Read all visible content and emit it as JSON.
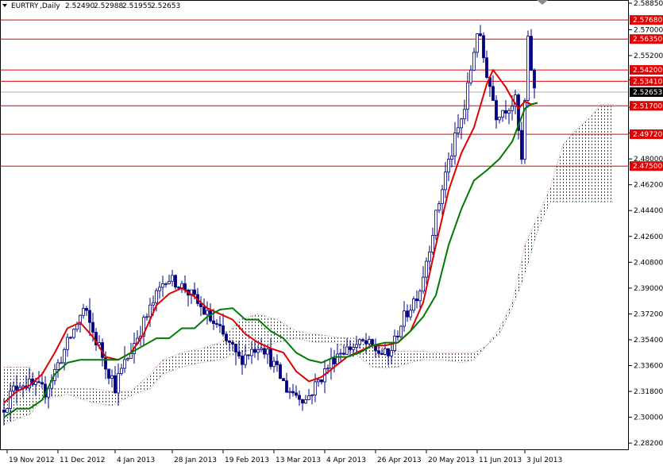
{
  "window": {
    "symbol": "EURTRY",
    "timeframe": "Daily",
    "ohlc": [
      "2.52490",
      "2.52988",
      "2.51955",
      "2.52653"
    ]
  },
  "chart_data": {
    "type": "candlestick",
    "title": "EURTRY,Daily",
    "ylim": [
      2.2782,
      2.5885
    ],
    "y_ticks": [
      2.5885,
      2.57,
      2.552,
      2.535,
      2.516,
      2.498,
      2.48,
      2.462,
      2.444,
      2.426,
      2.408,
      2.39,
      2.372,
      2.354,
      2.336,
      2.318,
      2.3,
      2.282
    ],
    "y_tick_labels": [
      "2.58850",
      "2.57000",
      "2.55200",
      "2.53500",
      "2.51600",
      "2.49800",
      "2.48000",
      "2.46200",
      "2.44400",
      "2.42600",
      "2.40800",
      "2.39000",
      "2.37200",
      "2.35400",
      "2.33600",
      "2.31800",
      "2.30000",
      "2.28200"
    ],
    "x_tick_labels": [
      "19 Nov 2012",
      "11 Dec 2012",
      "4 Jan 2013",
      "28 Jan 2013",
      "19 Feb 2013",
      "13 Mar 2013",
      "4 Apr 2013",
      "26 Apr 2013",
      "20 May 2013",
      "11 Jun 2013",
      "3 Jul 2013"
    ],
    "x_tick_index": [
      1,
      17,
      35,
      53,
      69,
      85,
      101,
      117,
      133,
      149,
      164
    ],
    "horizontal_levels": [
      {
        "value": 2.5768,
        "label": "2.57680"
      },
      {
        "value": 2.5635,
        "label": "2.56350"
      },
      {
        "value": 2.542,
        "label": "2.54200"
      },
      {
        "value": 2.5341,
        "label": "2.53410"
      },
      {
        "value": 2.517,
        "label": "2.51700"
      },
      {
        "value": 2.4972,
        "label": "2.49720"
      },
      {
        "value": 2.475,
        "label": "2.47500"
      }
    ],
    "current_price": {
      "value": 2.52653,
      "label": "2.52653"
    },
    "bars": [
      {
        "seg": [
          0,
          6
        ],
        "from": 2.305,
        "to": 2.325,
        "amp": 0.012
      },
      {
        "seg": [
          6,
          14
        ],
        "from": 2.325,
        "to": 2.318,
        "amp": 0.01
      },
      {
        "seg": [
          14,
          26
        ],
        "from": 2.318,
        "to": 2.375,
        "amp": 0.01
      },
      {
        "seg": [
          26,
          36
        ],
        "from": 2.375,
        "to": 2.322,
        "amp": 0.012
      },
      {
        "seg": [
          36,
          42
        ],
        "from": 2.322,
        "to": 2.352,
        "amp": 0.012
      },
      {
        "seg": [
          42,
          52
        ],
        "from": 2.352,
        "to": 2.398,
        "amp": 0.01
      },
      {
        "seg": [
          52,
          58
        ],
        "from": 2.398,
        "to": 2.39,
        "amp": 0.008
      },
      {
        "seg": [
          58,
          66
        ],
        "from": 2.39,
        "to": 2.368,
        "amp": 0.01
      },
      {
        "seg": [
          66,
          75
        ],
        "from": 2.368,
        "to": 2.34,
        "amp": 0.012
      },
      {
        "seg": [
          75,
          82
        ],
        "from": 2.34,
        "to": 2.352,
        "amp": 0.01
      },
      {
        "seg": [
          82,
          90
        ],
        "from": 2.352,
        "to": 2.32,
        "amp": 0.01
      },
      {
        "seg": [
          90,
          96
        ],
        "from": 2.32,
        "to": 2.312,
        "amp": 0.008
      },
      {
        "seg": [
          96,
          106
        ],
        "from": 2.312,
        "to": 2.345,
        "amp": 0.01
      },
      {
        "seg": [
          106,
          114
        ],
        "from": 2.345,
        "to": 2.352,
        "amp": 0.008
      },
      {
        "seg": [
          114,
          122
        ],
        "from": 2.352,
        "to": 2.342,
        "amp": 0.01
      },
      {
        "seg": [
          122,
          126
        ],
        "from": 2.342,
        "to": 2.365,
        "amp": 0.008
      },
      {
        "seg": [
          126,
          132
        ],
        "from": 2.365,
        "to": 2.39,
        "amp": 0.01
      },
      {
        "seg": [
          132,
          140
        ],
        "from": 2.39,
        "to": 2.47,
        "amp": 0.01
      },
      {
        "seg": [
          140,
          146
        ],
        "from": 2.47,
        "to": 2.515,
        "amp": 0.012
      },
      {
        "seg": [
          146,
          150
        ],
        "from": 2.515,
        "to": 2.57,
        "amp": 0.012
      },
      {
        "seg": [
          150,
          156
        ],
        "from": 2.57,
        "to": 2.512,
        "amp": 0.012
      },
      {
        "seg": [
          156,
          162
        ],
        "from": 2.512,
        "to": 2.52,
        "amp": 0.01
      },
      {
        "seg": [
          162,
          164
        ],
        "from": 2.52,
        "to": 2.478,
        "amp": 0.008
      },
      {
        "seg": [
          164,
          166
        ],
        "from": 2.478,
        "to": 2.56,
        "amp": 0.012
      },
      {
        "seg": [
          166,
          168
        ],
        "from": 2.56,
        "to": 2.527,
        "amp": 0.01
      }
    ],
    "series": [
      {
        "name": "",
        "color": "#e00000",
        "points": [
          [
            0,
            2.31
          ],
          [
            4,
            2.318
          ],
          [
            8,
            2.322
          ],
          [
            12,
            2.33
          ],
          [
            16,
            2.345
          ],
          [
            20,
            2.362
          ],
          [
            24,
            2.366
          ],
          [
            28,
            2.356
          ],
          [
            32,
            2.342
          ],
          [
            36,
            2.34
          ],
          [
            40,
            2.345
          ],
          [
            44,
            2.358
          ],
          [
            48,
            2.378
          ],
          [
            52,
            2.386
          ],
          [
            56,
            2.39
          ],
          [
            60,
            2.384
          ],
          [
            64,
            2.376
          ],
          [
            68,
            2.372
          ],
          [
            72,
            2.368
          ],
          [
            76,
            2.358
          ],
          [
            80,
            2.352
          ],
          [
            84,
            2.348
          ],
          [
            88,
            2.345
          ],
          [
            92,
            2.332
          ],
          [
            96,
            2.325
          ],
          [
            100,
            2.328
          ],
          [
            104,
            2.335
          ],
          [
            108,
            2.342
          ],
          [
            112,
            2.346
          ],
          [
            116,
            2.35
          ],
          [
            120,
            2.35
          ],
          [
            124,
            2.352
          ],
          [
            128,
            2.36
          ],
          [
            132,
            2.38
          ],
          [
            136,
            2.42
          ],
          [
            140,
            2.458
          ],
          [
            144,
            2.484
          ],
          [
            148,
            2.502
          ],
          [
            152,
            2.532
          ],
          [
            154,
            2.542
          ],
          [
            156,
            2.536
          ],
          [
            158,
            2.53
          ],
          [
            160,
            2.522
          ],
          [
            162,
            2.515
          ],
          [
            164,
            2.52
          ],
          [
            166,
            2.518
          ],
          [
            168,
            2.519
          ]
        ]
      },
      {
        "name": "",
        "color": "#007a00",
        "points": [
          [
            0,
            2.3
          ],
          [
            4,
            2.306
          ],
          [
            8,
            2.306
          ],
          [
            12,
            2.312
          ],
          [
            16,
            2.33
          ],
          [
            20,
            2.338
          ],
          [
            24,
            2.34
          ],
          [
            28,
            2.34
          ],
          [
            32,
            2.34
          ],
          [
            36,
            2.34
          ],
          [
            40,
            2.345
          ],
          [
            44,
            2.35
          ],
          [
            48,
            2.355
          ],
          [
            52,
            2.355
          ],
          [
            56,
            2.362
          ],
          [
            60,
            2.362
          ],
          [
            64,
            2.37
          ],
          [
            68,
            2.375
          ],
          [
            72,
            2.376
          ],
          [
            76,
            2.368
          ],
          [
            80,
            2.368
          ],
          [
            84,
            2.36
          ],
          [
            88,
            2.355
          ],
          [
            92,
            2.345
          ],
          [
            96,
            2.34
          ],
          [
            100,
            2.338
          ],
          [
            104,
            2.342
          ],
          [
            108,
            2.342
          ],
          [
            112,
            2.345
          ],
          [
            116,
            2.35
          ],
          [
            120,
            2.352
          ],
          [
            124,
            2.352
          ],
          [
            128,
            2.36
          ],
          [
            132,
            2.37
          ],
          [
            136,
            2.385
          ],
          [
            140,
            2.42
          ],
          [
            144,
            2.445
          ],
          [
            148,
            2.465
          ],
          [
            152,
            2.472
          ],
          [
            156,
            2.48
          ],
          [
            160,
            2.492
          ],
          [
            164,
            2.515
          ],
          [
            166,
            2.518
          ],
          [
            168,
            2.519
          ]
        ]
      }
    ],
    "cloud": {
      "upper": [
        [
          0,
          2.335
        ],
        [
          8,
          2.335
        ],
        [
          12,
          2.32
        ],
        [
          20,
          2.32
        ],
        [
          28,
          2.32
        ],
        [
          34,
          2.318
        ],
        [
          40,
          2.318
        ],
        [
          46,
          2.33
        ],
        [
          50,
          2.34
        ],
        [
          56,
          2.345
        ],
        [
          62,
          2.348
        ],
        [
          68,
          2.352
        ],
        [
          74,
          2.368
        ],
        [
          80,
          2.372
        ],
        [
          86,
          2.368
        ],
        [
          92,
          2.36
        ],
        [
          98,
          2.358
        ],
        [
          104,
          2.356
        ],
        [
          110,
          2.355
        ],
        [
          116,
          2.35
        ],
        [
          120,
          2.348
        ],
        [
          124,
          2.346
        ],
        [
          128,
          2.346
        ],
        [
          132,
          2.346
        ],
        [
          138,
          2.345
        ],
        [
          144,
          2.345
        ],
        [
          148,
          2.345
        ],
        [
          152,
          2.35
        ],
        [
          156,
          2.362
        ],
        [
          160,
          2.38
        ],
        [
          164,
          2.42
        ],
        [
          168,
          2.44
        ],
        [
          172,
          2.46
        ],
        [
          176,
          2.49
        ],
        [
          180,
          2.5
        ],
        [
          184,
          2.508
        ],
        [
          188,
          2.518
        ],
        [
          192,
          2.518
        ]
      ],
      "lower": [
        [
          0,
          2.295
        ],
        [
          8,
          2.302
        ],
        [
          12,
          2.312
        ],
        [
          20,
          2.316
        ],
        [
          28,
          2.31
        ],
        [
          34,
          2.308
        ],
        [
          40,
          2.315
        ],
        [
          46,
          2.32
        ],
        [
          50,
          2.33
        ],
        [
          56,
          2.335
        ],
        [
          62,
          2.338
        ],
        [
          68,
          2.34
        ],
        [
          74,
          2.345
        ],
        [
          80,
          2.348
        ],
        [
          86,
          2.352
        ],
        [
          92,
          2.355
        ],
        [
          98,
          2.352
        ],
        [
          104,
          2.352
        ],
        [
          110,
          2.345
        ],
        [
          116,
          2.335
        ],
        [
          120,
          2.334
        ],
        [
          124,
          2.335
        ],
        [
          128,
          2.338
        ],
        [
          132,
          2.34
        ],
        [
          138,
          2.34
        ],
        [
          144,
          2.338
        ],
        [
          148,
          2.34
        ],
        [
          152,
          2.35
        ],
        [
          156,
          2.358
        ],
        [
          160,
          2.376
        ],
        [
          164,
          2.4
        ],
        [
          168,
          2.43
        ],
        [
          172,
          2.45
        ],
        [
          176,
          2.45
        ],
        [
          180,
          2.45
        ],
        [
          184,
          2.45
        ],
        [
          188,
          2.45
        ],
        [
          192,
          2.45
        ]
      ]
    }
  }
}
